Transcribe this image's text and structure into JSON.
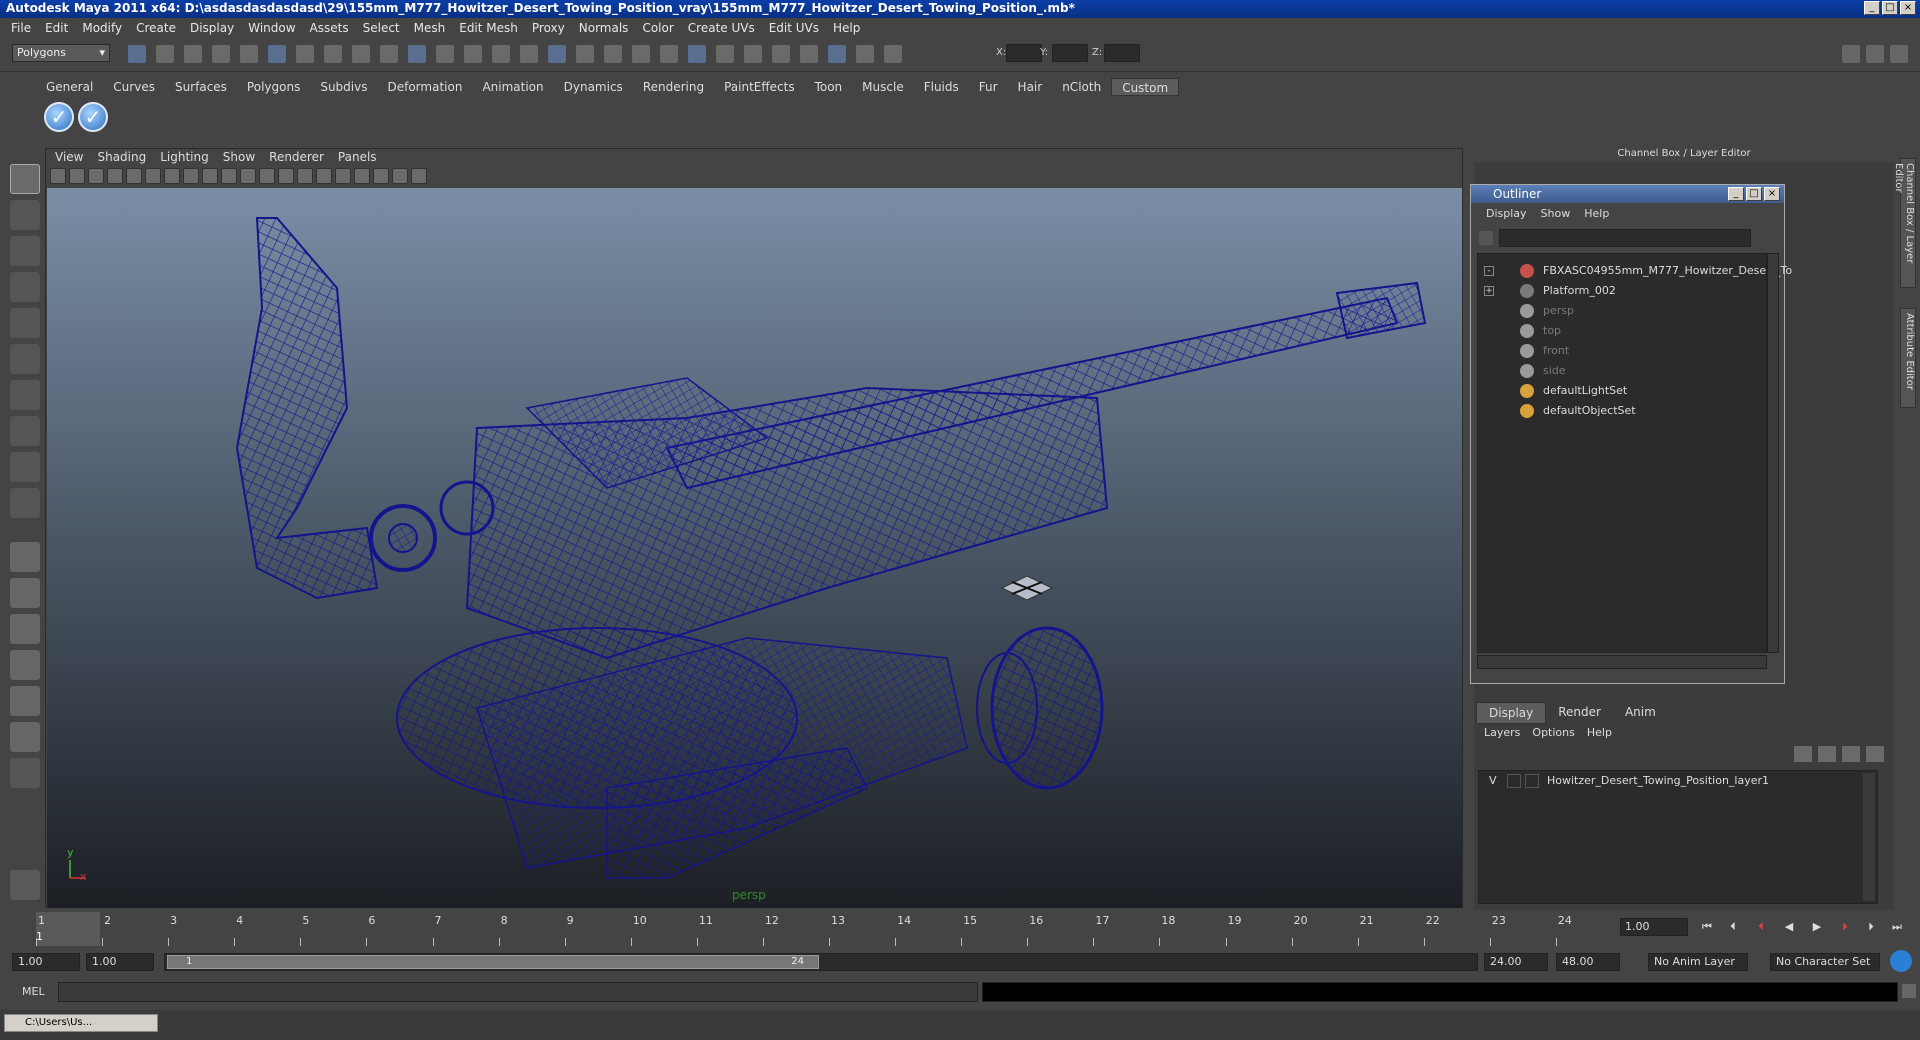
{
  "window": {
    "title": "Autodesk Maya 2011 x64: D:\\asdasdasdasdasd\\29\\155mm_M777_Howitzer_Desert_Towing_Position_vray\\155mm_M777_Howitzer_Desert_Towing_Position_.mb*"
  },
  "menubar": [
    "File",
    "Edit",
    "Modify",
    "Create",
    "Display",
    "Window",
    "Assets",
    "Select",
    "Mesh",
    "Edit Mesh",
    "Proxy",
    "Normals",
    "Color",
    "Create UVs",
    "Edit UVs",
    "Help"
  ],
  "statusline": {
    "mode": "Polygons",
    "x_label": "X:",
    "y_label": "Y:",
    "z_label": "Z:"
  },
  "shelf": {
    "tabs": [
      "General",
      "Curves",
      "Surfaces",
      "Polygons",
      "Subdivs",
      "Deformation",
      "Animation",
      "Dynamics",
      "Rendering",
      "PaintEffects",
      "Toon",
      "Muscle",
      "Fluids",
      "Fur",
      "Hair",
      "nCloth",
      "Custom"
    ],
    "active_tab": "Custom"
  },
  "panel": {
    "menu": [
      "View",
      "Shading",
      "Lighting",
      "Show",
      "Renderer",
      "Panels"
    ],
    "camera": "persp",
    "axis_y": "y",
    "axis_x": "x"
  },
  "channel_box": {
    "header": "Channel Box / Layer Editor"
  },
  "side_tabs": [
    "Channel Box / Layer Editor",
    "Attribute Editor"
  ],
  "outliner": {
    "title": "Outliner",
    "menu": [
      "Display",
      "Show",
      "Help"
    ],
    "items": [
      {
        "label": "FBXASC04955mm_M777_Howitzer_Desert_To",
        "icon": "transform-icon",
        "expander": "-",
        "dim": false
      },
      {
        "label": "Platform_002",
        "icon": "mesh-icon",
        "expander": "+",
        "dim": false
      },
      {
        "label": "persp",
        "icon": "camera-icon",
        "expander": "",
        "dim": true
      },
      {
        "label": "top",
        "icon": "camera-icon",
        "expander": "",
        "dim": true
      },
      {
        "label": "front",
        "icon": "camera-icon",
        "expander": "",
        "dim": true
      },
      {
        "label": "side",
        "icon": "camera-icon",
        "expander": "",
        "dim": true
      },
      {
        "label": "defaultLightSet",
        "icon": "set-icon",
        "expander": "",
        "dim": false
      },
      {
        "label": "defaultObjectSet",
        "icon": "set-icon",
        "expander": "",
        "dim": false
      }
    ]
  },
  "layer_editor": {
    "tabs": [
      "Display",
      "Render",
      "Anim"
    ],
    "active_tab": "Display",
    "menu": [
      "Layers",
      "Options",
      "Help"
    ],
    "layers": [
      {
        "visible": "V",
        "name": "Howitzer_Desert_Towing_Position_layer1"
      }
    ]
  },
  "timeline": {
    "ticks": [
      "1",
      "2",
      "3",
      "4",
      "5",
      "6",
      "7",
      "8",
      "9",
      "10",
      "11",
      "12",
      "13",
      "14",
      "15",
      "16",
      "17",
      "18",
      "19",
      "20",
      "21",
      "22",
      "23",
      "24"
    ],
    "current_frame": "1.00",
    "start_marker": "1"
  },
  "range": {
    "start": "1.00",
    "playback_start": "1.00",
    "slider_start": "1",
    "slider_end": "24",
    "playback_end": "24.00",
    "end": "48.00",
    "anim_layer": "No Anim Layer",
    "character_set": "No Character Set"
  },
  "command_line": {
    "label": "MEL"
  },
  "taskbar": {
    "item": "C:\\Users\\Us..."
  },
  "colors": {
    "wireframe": "#14148c",
    "titlebar": "#0b3fa8",
    "viewport_top": "#7a8ea6",
    "viewport_bottom": "#1c1f24"
  }
}
